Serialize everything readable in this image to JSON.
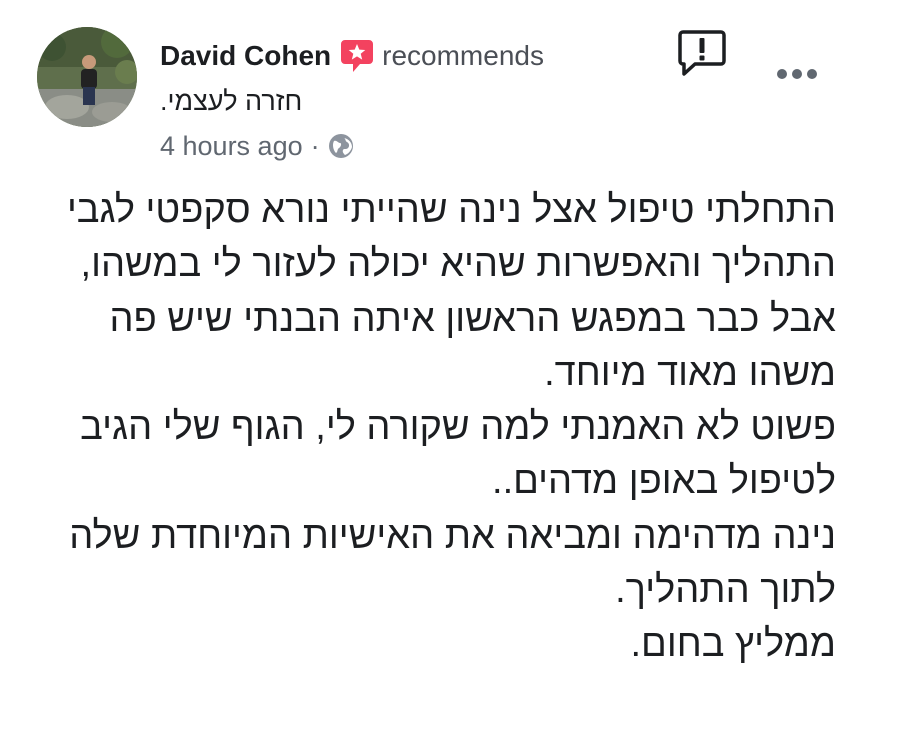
{
  "post": {
    "author": "David Cohen",
    "action": "recommends",
    "page_name": "חזרה לעצמי.",
    "timestamp": "4 hours ago",
    "separator": "·",
    "audience_icon": "globe-icon",
    "body_lines": [
      "התחלתי טיפול אצל נינה שהייתי נורא סקפטי לגבי",
      "התהליך והאפשרות שהיא יכולה לעזור לי במשהו,",
      "אבל כבר במפגש הראשון איתה הבנתי שיש פה",
      "משהו מאוד מיוחד.",
      "פשוט לא האמנתי למה שקורה לי, הגוף שלי הגיב",
      "לטיפול באופן מדהים..",
      "נינה מדהימה ומביאה את האישיות המיוחדת שלה",
      "לתוך התהליך.",
      "ממליץ בחום."
    ]
  },
  "icons": {
    "recommend": "recommend-star-icon",
    "report": "report-icon",
    "more": "more-options-icon"
  },
  "colors": {
    "recommend_badge": "#f3425f",
    "secondary_text": "#606770",
    "primary_text": "#1c1e21"
  }
}
